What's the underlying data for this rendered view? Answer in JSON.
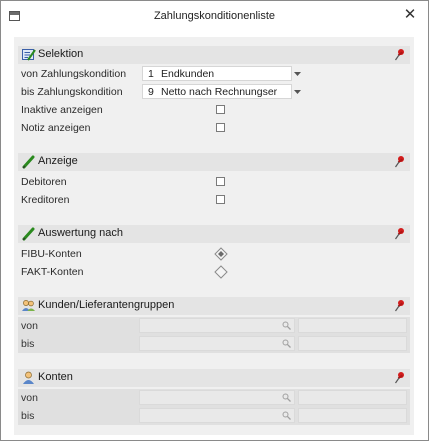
{
  "window": {
    "title": "Zahlungskonditionenliste",
    "close_glyph": "✕"
  },
  "sections": {
    "selektion": {
      "label": "Selektion",
      "von": {
        "label": "von Zahlungskondition",
        "number": "1",
        "text": "Endkunden"
      },
      "bis": {
        "label": "bis Zahlungskondition",
        "number": "9",
        "text": "Netto nach Rechnungser"
      },
      "inaktive": {
        "label": "Inaktive anzeigen",
        "checked": false
      },
      "notiz": {
        "label": "Notiz anzeigen",
        "checked": false
      }
    },
    "anzeige": {
      "label": "Anzeige",
      "debitoren": {
        "label": "Debitoren",
        "checked": false
      },
      "kreditoren": {
        "label": "Kreditoren",
        "checked": false
      }
    },
    "auswertung": {
      "label": "Auswertung nach",
      "fibu": {
        "label": "FIBU-Konten",
        "selected": true
      },
      "fakt": {
        "label": "FAKT-Konten",
        "selected": false
      }
    },
    "gruppen": {
      "label": "Kunden/Lieferantengruppen",
      "von_label": "von",
      "bis_label": "bis"
    },
    "konten": {
      "label": "Konten",
      "von_label": "von",
      "bis_label": "bis"
    }
  },
  "icons": {
    "selektion": "list-pencil-icon",
    "anzeige": "pencil-icon",
    "auswertung": "pencil-icon",
    "gruppen": "user-group-icon",
    "konten": "user-icon",
    "pin": "red-pin-icon",
    "search": "magnifier-icon"
  },
  "colors": {
    "pin": "#d21c1c",
    "pencil": "#2a8a1e",
    "section_bg": "#e4e4e4",
    "content_bg": "#f0f0f0"
  }
}
